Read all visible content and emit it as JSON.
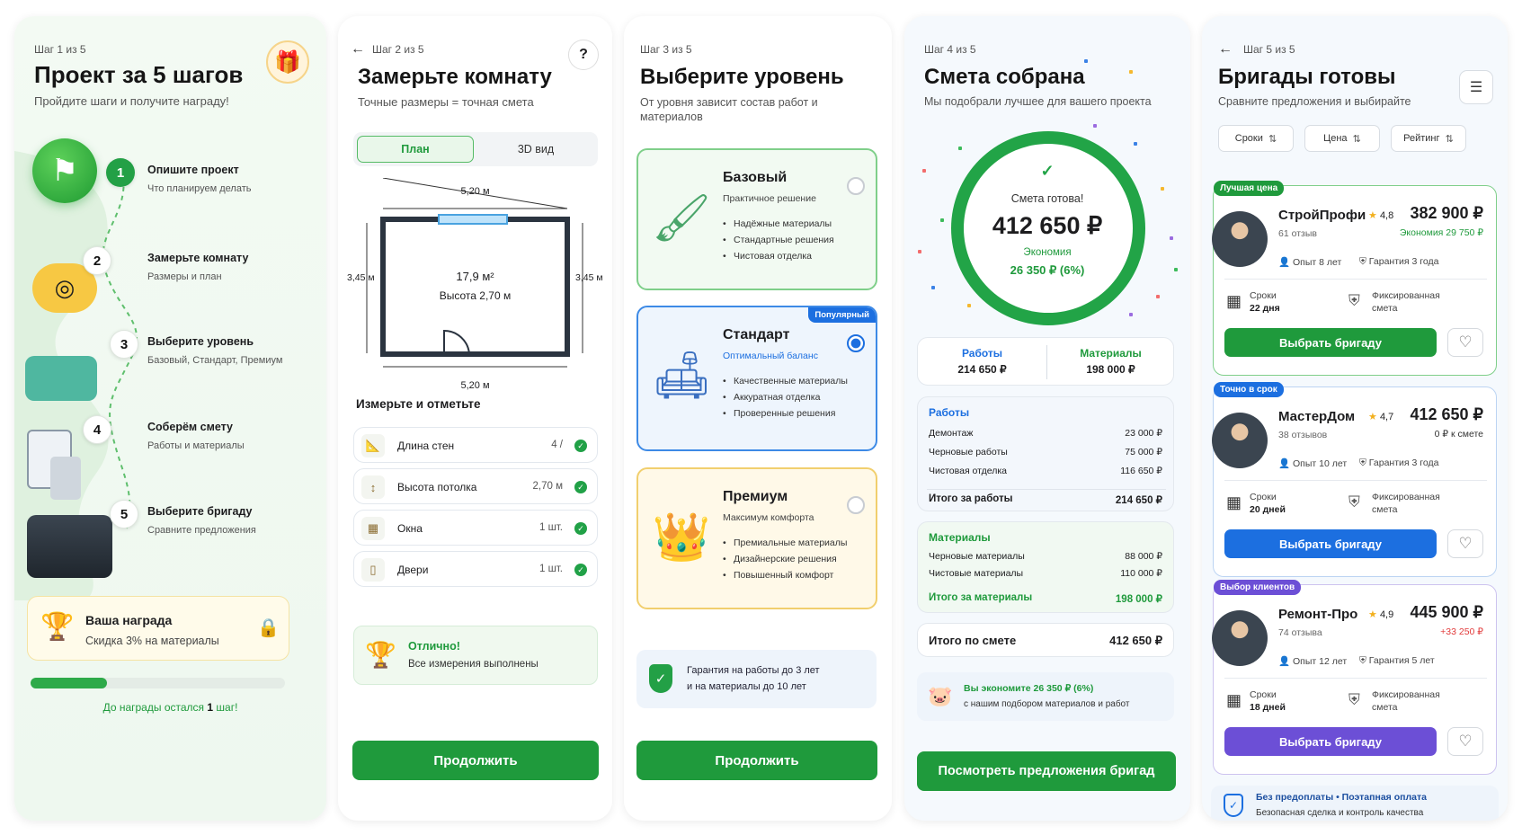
{
  "s1": {
    "step": "Шаг 1 из 5",
    "title": "Проект за 5 шагов",
    "subtitle": "Пройдите шаги и получите награду!",
    "steps": [
      {
        "num": "1",
        "title": "Опишите проект",
        "desc": "Что планируем делать"
      },
      {
        "num": "2",
        "title": "Замерьте комнату",
        "desc": "Размеры и план"
      },
      {
        "num": "3",
        "title": "Выберите уровень",
        "desc": "Базовый, Стандарт, Премиум"
      },
      {
        "num": "4",
        "title": "Соберём смету",
        "desc": "Работы и материалы"
      },
      {
        "num": "5",
        "title": "Выберите бригаду",
        "desc": "Сравните предложения"
      }
    ],
    "reward_title": "Ваша награда",
    "reward_desc": "Скидка 3% на материалы",
    "progress_pre": "До награды остался ",
    "progress_num": "1",
    "progress_post": " шаг!",
    "progress_fraction": 0.3
  },
  "s2": {
    "step": "Шаг 2 из 5",
    "title": "Замерьте комнату",
    "subtitle": "Точные размеры = точная смета",
    "help": "?",
    "tabs": [
      "План",
      "3D вид"
    ],
    "plan": {
      "width_top": "5,20 м",
      "width_bottom": "5,20 м",
      "height_left": "3,45 м",
      "height_right": "3,45 м",
      "area": "17,9 м²",
      "ceiling": "Высота 2,70 м"
    },
    "measure_title": "Измерьте и отметьте",
    "items": [
      {
        "label": "Длина стен",
        "value": "4 /"
      },
      {
        "label": "Высота потолка",
        "value": "2,70 м"
      },
      {
        "label": "Окна",
        "value": "1 шт."
      },
      {
        "label": "Двери",
        "value": "1 шт."
      }
    ],
    "success_title": "Отлично!",
    "success_desc": "Все измерения выполнены",
    "cta": "Продолжить"
  },
  "s3": {
    "step": "Шаг 3 из 5",
    "title": "Выберите уровень",
    "subtitle": "От уровня зависит состав работ и материалов",
    "levels": [
      {
        "name": "Базовый",
        "desc": "Практичное решение",
        "bullets": [
          "Надёжные материалы",
          "Стандартные решения",
          "Чистовая отделка"
        ]
      },
      {
        "name": "Стандарт",
        "desc": "Оптимальный баланс",
        "badge": "Популярный",
        "bullets": [
          "Качественные материалы",
          "Аккуратная отделка",
          "Проверенные решения"
        ]
      },
      {
        "name": "Премиум",
        "desc": "Максимум комфорта",
        "bullets": [
          "Премиальные материалы",
          "Дизайнерские решения",
          "Повышенный комфорт"
        ]
      }
    ],
    "guarantee_l1": "Гарантия на работы до 3 лет",
    "guarantee_l2": "и на материалы до 10 лет",
    "cta": "Продолжить"
  },
  "s4": {
    "step": "Шаг 4 из 5",
    "title": "Смета собрана",
    "subtitle": "Мы подобрали лучшее для вашего проекта",
    "ready": "Смета готова!",
    "total": "412 650 ₽",
    "savings_label": "Экономия",
    "savings": "26 350 ₽ (6%)",
    "works_label": "Работы",
    "works_sum": "214 650 ₽",
    "materials_label": "Материалы",
    "materials_sum": "198 000 ₽",
    "works_title": "Работы",
    "works": [
      [
        "Демонтаж",
        "23 000 ₽"
      ],
      [
        "Черновые работы",
        "75 000 ₽"
      ],
      [
        "Чистовая отделка",
        "116 650 ₽"
      ]
    ],
    "works_total_label": "Итого за работы",
    "works_total": "214 650 ₽",
    "mats_title": "Материалы",
    "mats": [
      [
        "Черновые материалы",
        "88 000 ₽"
      ],
      [
        "Чистовые материалы",
        "110 000 ₽"
      ]
    ],
    "mats_total_label": "Итого за материалы",
    "mats_total": "198 000 ₽",
    "grand_label": "Итого по смете",
    "grand": "412 650 ₽",
    "save_note_title": "Вы экономите 26 350 ₽ (6%)",
    "save_note_desc": "с нашим подбором материалов и работ",
    "cta": "Посмотреть предложения бригад"
  },
  "s5": {
    "step": "Шаг 5 из 5",
    "title": "Бригады готовы",
    "subtitle": "Сравните предложения и выбирайте",
    "sorts": [
      "Сроки",
      "Цена",
      "Рейтинг"
    ],
    "teams": [
      {
        "tag": "Лучшая цена",
        "name": "СтройПрофи",
        "rating": "4,8",
        "price": "382 900 ₽",
        "price_note": "Экономия 29 750 ₽",
        "reviews": "61 отзыв",
        "exp": "Опыт 8 лет",
        "warranty": "Гарантия 3 года",
        "term_label": "Сроки",
        "term": "22 дня",
        "fixed": "Фиксированная",
        "fixed2": "смета",
        "cta": "Выбрать бригаду",
        "color": "#1f9a3c"
      },
      {
        "tag": "Точно в срок",
        "name": "МастерДом",
        "rating": "4,7",
        "price": "412 650 ₽",
        "price_note": "0 ₽ к смете",
        "reviews": "38 отзывов",
        "exp": "Опыт 10 лет",
        "warranty": "Гарантия 3 года",
        "term_label": "Сроки",
        "term": "20 дней",
        "fixed": "Фиксированная",
        "fixed2": "смета",
        "cta": "Выбрать бригаду",
        "color": "#1c6fe0"
      },
      {
        "tag": "Выбор клиентов",
        "name": "Ремонт-Про",
        "rating": "4,9",
        "price": "445 900 ₽",
        "price_note": "+33 250 ₽",
        "reviews": "74 отзыва",
        "exp": "Опыт 12 лет",
        "warranty": "Гарантия 5 лет",
        "term_label": "Сроки",
        "term": "18 дней",
        "fixed": "Фиксированная",
        "fixed2": "смета",
        "cta": "Выбрать бригаду",
        "color": "#6c4fd6"
      }
    ],
    "footer_title": "Без предоплаты • Поэтапная оплата",
    "footer_desc": "Безопасная сделка и контроль качества"
  },
  "colors": {
    "green": "#1f9a3c",
    "blue": "#1c6fe0",
    "purple": "#6c4fd6",
    "red": "#e23b3b"
  }
}
